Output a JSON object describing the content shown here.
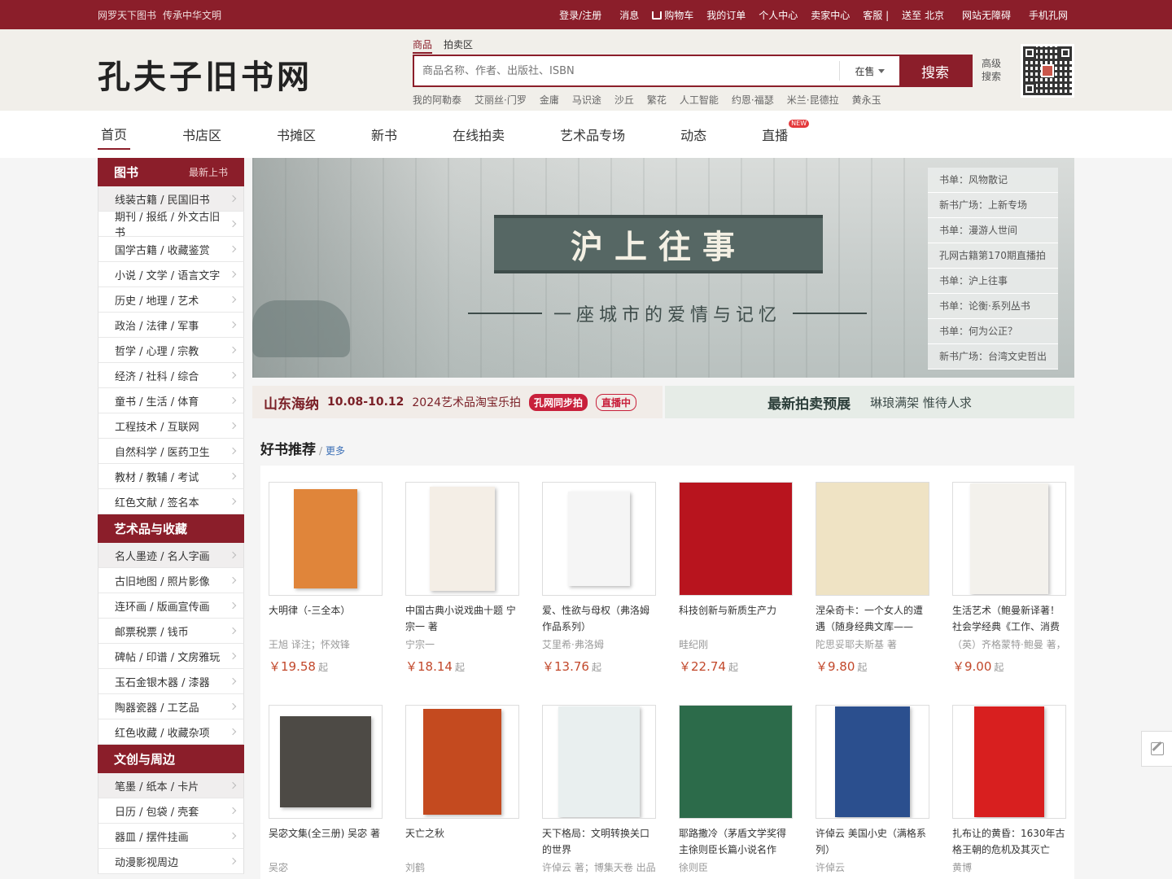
{
  "topbar": {
    "slogan": [
      "网罗天下图书",
      "传承中华文明"
    ],
    "links": [
      "登录/注册",
      "消息",
      "购物车",
      "我的订单",
      "个人中心",
      "卖家中心",
      "客服 |",
      "送至 北京",
      "网站无障碍",
      "手机孔网"
    ]
  },
  "header": {
    "logo": "孔夫子旧书网",
    "search_tabs": [
      "商品",
      "拍卖区"
    ],
    "search_placeholder": "商品名称、作者、出版社、ISBN",
    "search_scope": "在售",
    "search_button": "搜索",
    "advanced_search": "高级搜索",
    "hot_words": [
      "我的阿勒泰",
      "艾丽丝·门罗",
      "金庸",
      "马识途",
      "沙丘",
      "繁花",
      "人工智能",
      "约恩·福瑟",
      "米兰·昆德拉",
      "黄永玉"
    ]
  },
  "nav": {
    "items": [
      "首页",
      "书店区",
      "书摊区",
      "新书",
      "在线拍卖",
      "艺术品专场",
      "动态",
      "直播"
    ],
    "new_badge": "NEW"
  },
  "sidebar": {
    "groups": [
      {
        "title": "图书",
        "sub": "最新上书",
        "items": [
          "线装古籍 / 民国旧书",
          "期刊 / 报纸 / 外文古旧书",
          "国学古籍 / 收藏鉴赏",
          "小说 / 文学 / 语言文字",
          "历史 / 地理 / 艺术",
          "政治 / 法律 / 军事",
          "哲学 / 心理 / 宗教",
          "经济 / 社科 / 综合",
          "童书 / 生活 / 体育",
          "工程技术 / 互联网",
          "自然科学 / 医药卫生",
          "教材 / 教辅 / 考试",
          "红色文献 / 签名本"
        ]
      },
      {
        "title": "艺术品与收藏",
        "sub": "",
        "items": [
          "名人墨迹 / 名人字画",
          "古旧地图 / 照片影像",
          "连环画 / 版画宣传画",
          "邮票税票 / 钱币",
          "碑帖 / 印谱 / 文房雅玩",
          "玉石金银木器 / 漆器",
          "陶器瓷器 / 工艺品",
          "红色收藏 / 收藏杂项"
        ]
      },
      {
        "title": "文创与周边",
        "sub": "",
        "items": [
          "笔墨 / 纸本 / 卡片",
          "日历 / 包袋 / 壳套",
          "器皿 / 摆件挂画",
          "动漫影视周边"
        ]
      }
    ]
  },
  "banner": {
    "title": "沪上往事",
    "subtitle": "一座城市的爱情与记忆",
    "list": [
      "书单：风物散记",
      "新书广场：上新专场",
      "书单：漫游人世间",
      "孔网古籍第170期直播拍",
      "书单：沪上往事",
      "书单：论衡·系列丛书",
      "书单：何为公正？",
      "新书广场：台湾文史哲出"
    ]
  },
  "promo": {
    "left_place": "山东海纳",
    "left_date": "10.08-10.12",
    "left_event": "2024艺术品淘宝乐拍",
    "left_tag1": "孔网同步拍",
    "left_tag2": "直播中",
    "right_title": "最新拍卖预展",
    "right_sub": "琳琅满架 惟待人求"
  },
  "recommend": {
    "title": "好书推荐",
    "more": "更多",
    "price_suffix": "起",
    "books": [
      {
        "name": "大明律（-三全本）",
        "author": "王旭 译注；怀效锋",
        "price": "￥19.58",
        "color": "#e0853a",
        "w": 78,
        "h": 122
      },
      {
        "name": "中国古典小说戏曲十题 宁宗一 著",
        "author": "宁宗一",
        "price": "￥18.14",
        "color": "#f4eee6",
        "w": 80,
        "h": 128
      },
      {
        "name": "爱、性欲与母权（弗洛姆作品系列）",
        "author": "艾里希·弗洛姆",
        "price": "￥13.76",
        "color": "#f5f5f5",
        "w": 76,
        "h": 116
      },
      {
        "name": "科技创新与新质生产力",
        "author": "畦纪刚",
        "price": "￥22.74",
        "color": "#b8141e",
        "w": 140,
        "h": 140
      },
      {
        "name": "涅朵奇卡：一个女人的遭遇（随身经典文库——",
        "author": "陀思妥耶夫斯基 著",
        "price": "￥9.80",
        "color": "#efe3c4",
        "w": 140,
        "h": 140
      },
      {
        "name": "生活艺术（鲍曼新译著！社会学经典《工作、消费",
        "author": "（英）齐格蒙特·鲍曼 著，",
        "price": "￥9.00",
        "color": "#f3f1ec",
        "w": 96,
        "h": 136
      },
      {
        "name": "吴宓文集(全三册) 吴宓 著",
        "author": "吴宓",
        "price": "",
        "color": "#4d4a45",
        "w": 112,
        "h": 112
      },
      {
        "name": "天亡之秋",
        "author": "刘鹤",
        "price": "",
        "color": "#c44a1f",
        "w": 96,
        "h": 130
      },
      {
        "name": "天下格局：文明转换关口的世界",
        "author": "许倬云 著；博集天卷 出品",
        "price": "",
        "color": "#e9efef",
        "w": 100,
        "h": 136
      },
      {
        "name": "耶路撒冷（茅盾文学奖得主徐则臣长篇小说名作",
        "author": "徐则臣",
        "price": "",
        "color": "#2c6b4a",
        "w": 140,
        "h": 140
      },
      {
        "name": "许倬云 美国小史（满格系列）",
        "author": "许倬云",
        "price": "",
        "color": "#2b4f8e",
        "w": 92,
        "h": 136
      },
      {
        "name": "扎布让的黄昏：1630年古格王朝的危机及其灭亡",
        "author": "黄博",
        "price": "",
        "color": "#d81f1f",
        "w": 86,
        "h": 136
      }
    ]
  }
}
